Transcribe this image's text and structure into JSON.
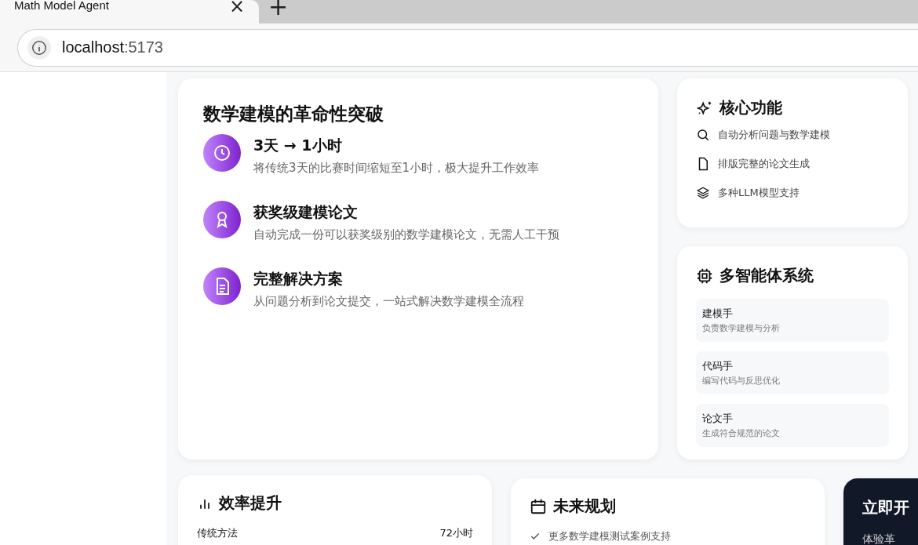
{
  "browser": {
    "tab_title": "Math Model Agent",
    "close": "×",
    "new_tab": "+",
    "url_host": "localhost",
    "url_port": ":5173"
  },
  "hero": {
    "title": "数学建模的革命性突破",
    "features": [
      {
        "kind": "clock",
        "title": "3天 → 1小时",
        "desc": "将传统3天的比赛时间缩短至1小时，极大提升工作效率"
      },
      {
        "kind": "award",
        "title": "获奖级建模论文",
        "desc": "自动完成一份可以获奖级别的数学建模论文，无需人工干预"
      },
      {
        "kind": "doc",
        "title": "完整解决方案",
        "desc": "从问题分析到论文提交，一站式解决数学建模全流程"
      }
    ]
  },
  "core": {
    "title": "核心功能",
    "items": [
      {
        "kind": "search",
        "text": "自动分析问题与数学建模"
      },
      {
        "kind": "file",
        "text": "排版完整的论文生成"
      },
      {
        "kind": "layers",
        "text": "多种LLM模型支持"
      }
    ]
  },
  "agents": {
    "title": "多智能体系统",
    "items": [
      {
        "name": "建模手",
        "desc": "负责数学建模与分析"
      },
      {
        "name": "代码手",
        "desc": "编写代码与反思优化"
      },
      {
        "name": "论文手",
        "desc": "生成符合规范的论文"
      }
    ]
  },
  "efficiency": {
    "title": "效率提升",
    "rows": [
      {
        "label": "传统方法",
        "value": "72小时"
      }
    ]
  },
  "roadmap": {
    "title": "未来规划",
    "items": [
      "更多数学建模测试案例支持"
    ]
  },
  "cta": {
    "title": "立即开",
    "desc": "体验革"
  }
}
